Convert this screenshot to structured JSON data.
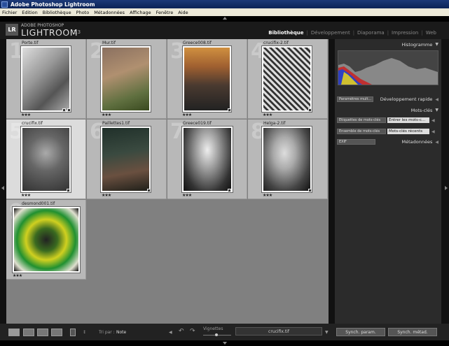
{
  "window": {
    "title": "Adobe Photoshop Lightroom"
  },
  "menu": [
    "Fichier",
    "Edition",
    "Bibliothèque",
    "Photo",
    "Métadonnées",
    "Affichage",
    "Fenêtre",
    "Aide"
  ],
  "brand": {
    "logo": "LR",
    "line1": "ADOBE PHOTOSHOP",
    "line2": "LIGHTROOM",
    "version": "1.3"
  },
  "modules": [
    "Bibliothèque",
    "Développement",
    "Diaporama",
    "Impression",
    "Web"
  ],
  "photos": [
    {
      "num": "1",
      "name": "Porte.tif",
      "stars": "★★★"
    },
    {
      "num": "2",
      "name": "Mur.tif",
      "stars": "★★★"
    },
    {
      "num": "3",
      "name": "Greece008.tif",
      "stars": "★★★"
    },
    {
      "num": "4",
      "name": "crucifix-2.tif",
      "stars": "★★★"
    },
    {
      "num": "5",
      "name": "crucifix.tif",
      "stars": "★★★"
    },
    {
      "num": "6",
      "name": "Paillettes1.tif",
      "stars": "★★★"
    },
    {
      "num": "7",
      "name": "Greece019.tif",
      "stars": "★★★"
    },
    {
      "num": "8",
      "name": "Helga-2.tif",
      "stars": "★★★"
    },
    {
      "num": "9",
      "name": "desmond001.tif",
      "stars": "★★★"
    }
  ],
  "right_panel": {
    "histogram": "Histogramme",
    "presets_btn": "Paramètres mult...",
    "quick_develop": "Développement rapide",
    "keywords": "Mots-clés",
    "keyword_tags_label": "Etiquettes de mots-clés",
    "keyword_tags_value": "Entrer les mots-c...",
    "keyword_set_label": "Ensemble de mots-clés",
    "keyword_set_value": "Mots-clés récents",
    "exif_value": "EXIF",
    "metadata": "Métadonnées"
  },
  "toolbar": {
    "sort_label": "Tri par :",
    "sort_value": "Note",
    "vignettes": "Vignettes",
    "filename": "crucifix.tif",
    "sync_params": "Synch. param.",
    "sync_meta": "Synch. métad."
  }
}
